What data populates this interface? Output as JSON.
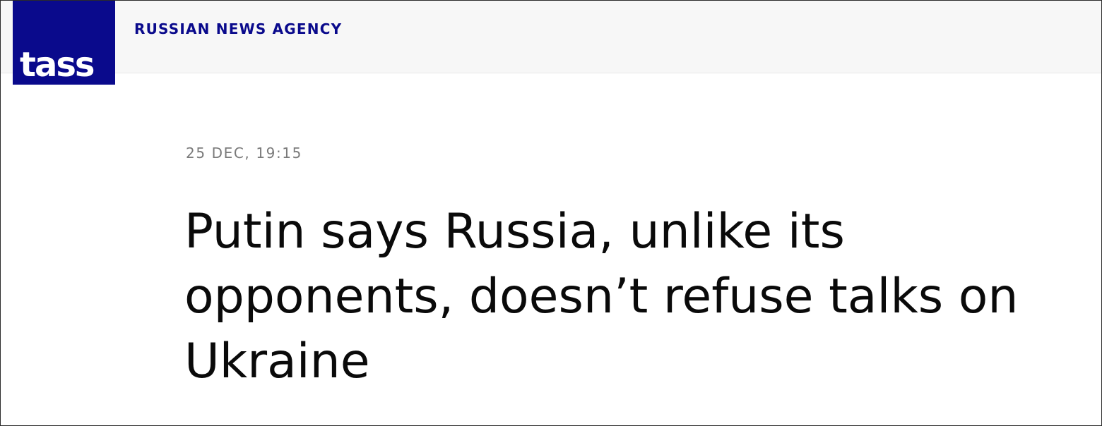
{
  "header": {
    "logo_text": "tass",
    "agency_name": "RUSSIAN NEWS AGENCY",
    "logo_color": "#0a0a8c",
    "background_color": "#f7f7f7"
  },
  "article": {
    "dateline": "25 DEC, 19:15",
    "headline": "Putin says Russia, unlike its opponents, doesn’t refuse talks on Ukraine"
  }
}
